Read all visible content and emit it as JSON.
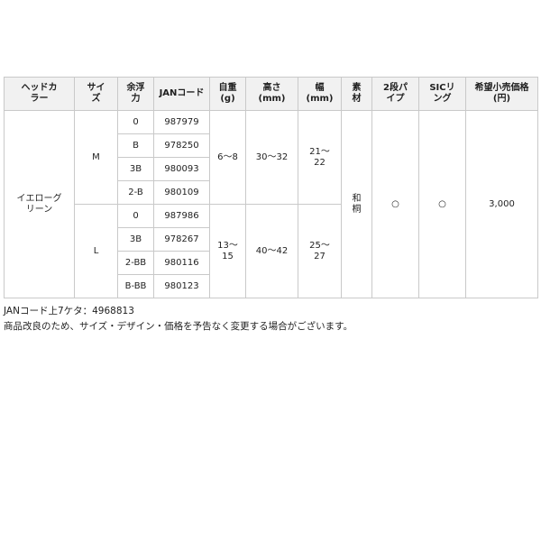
{
  "table": {
    "headers": [
      [
        "ヘッドカ",
        "ラー"
      ],
      [
        "サイ",
        "ズ"
      ],
      [
        "余浮",
        "力"
      ],
      [
        "JANコード"
      ],
      [
        "自重",
        "(g)"
      ],
      [
        "高さ",
        "(mm)"
      ],
      [
        "幅",
        "(mm)"
      ],
      [
        "素",
        "材"
      ],
      [
        "2段パ",
        "イプ"
      ],
      [
        "SICリ",
        "ング"
      ],
      [
        "希望小売価格",
        "(円)"
      ]
    ],
    "head_color": [
      "イエローグ",
      "リーン"
    ],
    "material": [
      "和",
      "桐"
    ],
    "two_step_pipe": "○",
    "sic_ring": "○",
    "price": "3,000",
    "groups": [
      {
        "size": "M",
        "weight": [
          "6〜8"
        ],
        "height": [
          "30〜32"
        ],
        "width": [
          "21〜",
          "22"
        ],
        "rows": [
          {
            "buoyancy": "0",
            "jan": "987979"
          },
          {
            "buoyancy": "B",
            "jan": "978250"
          },
          {
            "buoyancy": "3B",
            "jan": "980093"
          },
          {
            "buoyancy": "2-B",
            "jan": "980109"
          }
        ]
      },
      {
        "size": "L",
        "weight": [
          "13〜",
          "15"
        ],
        "height": [
          "40〜42"
        ],
        "width": [
          "25〜",
          "27"
        ],
        "rows": [
          {
            "buoyancy": "0",
            "jan": "987986"
          },
          {
            "buoyancy": "3B",
            "jan": "978267"
          },
          {
            "buoyancy": "2-BB",
            "jan": "980116"
          },
          {
            "buoyancy": "B-BB",
            "jan": "980123"
          }
        ]
      }
    ]
  },
  "notes": {
    "jan_prefix": "JANコード上7ケタ：4968813",
    "disclaimer": "商品改良のため、サイズ・デザイン・価格を予告なく変更する場合がございます。"
  }
}
